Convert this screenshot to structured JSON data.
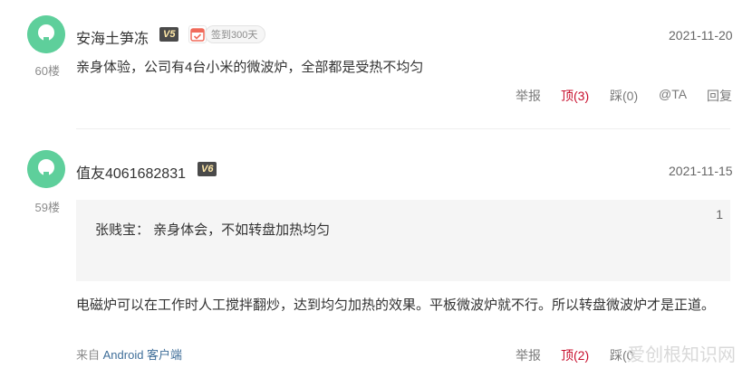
{
  "comments": [
    {
      "username": "安海土笋冻",
      "level_badge": "V5",
      "sign_badge": "签到300天",
      "date": "2021-11-20",
      "floor": "60楼",
      "content": "亲身体验，公司有4台小米的微波炉，全部都是受热不均匀",
      "actions": {
        "report": "举报",
        "up": "顶(3)",
        "down": "踩(0)",
        "at": "@TA",
        "reply": "回复"
      }
    },
    {
      "username": "值友4061682831",
      "level_badge": "V6",
      "date": "2021-11-15",
      "floor": "59楼",
      "quote": {
        "text": "张贱宝： 亲身体会，不如转盘加热均匀",
        "index": "1"
      },
      "content": "电磁炉可以在工作时人工搅拌翻炒，达到均匀加热的效果。平板微波炉就不行。所以转盘微波炉才是正道。",
      "source_prefix": "来自",
      "source_link": "Android 客户端",
      "actions": {
        "report": "举报",
        "up": "顶(2)",
        "down": "踩(0"
      }
    }
  ],
  "watermark": "爱创根知识网",
  "colors": {
    "avatar": "#5ecf9b",
    "up": "#c8102e",
    "link": "#3f6e99",
    "quote_bg": "#f5f5f5"
  },
  "icons": [
    "avatar-icon",
    "calendar-check-icon"
  ]
}
